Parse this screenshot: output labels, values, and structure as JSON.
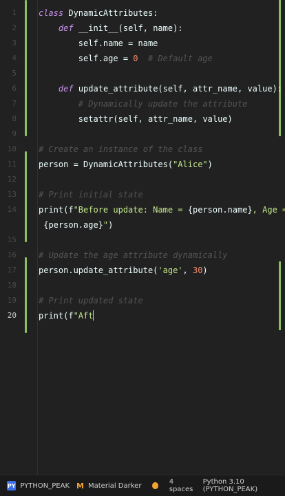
{
  "editor": {
    "line_numbers": [
      "1",
      "2",
      "3",
      "4",
      "5",
      "6",
      "7",
      "8",
      "9",
      "10",
      "11",
      "12",
      "13",
      "14",
      "15",
      "16",
      "17",
      "18",
      "19",
      "20"
    ],
    "lines": [
      [
        {
          "t": "class",
          "c": "kw"
        },
        {
          "t": " DynamicAttributes:",
          "c": "plain"
        }
      ],
      [
        {
          "t": "    ",
          "c": "plain"
        },
        {
          "t": "def",
          "c": "kw"
        },
        {
          "t": " __init__(self, name):",
          "c": "plain"
        }
      ],
      [
        {
          "t": "        self.name = name",
          "c": "plain"
        }
      ],
      [
        {
          "t": "        self.age = ",
          "c": "plain"
        },
        {
          "t": "0",
          "c": "num"
        },
        {
          "t": "  # Default age",
          "c": "cm"
        }
      ],
      [],
      [
        {
          "t": "    ",
          "c": "plain"
        },
        {
          "t": "def",
          "c": "kw"
        },
        {
          "t": " update_attribute(self, attr_name, value):",
          "c": "plain"
        }
      ],
      [
        {
          "t": "        # Dynamically update the attribute",
          "c": "cm"
        }
      ],
      [
        {
          "t": "        setattr(self, attr_name, value)",
          "c": "plain"
        }
      ],
      [],
      [
        {
          "t": "# Create an instance of the class",
          "c": "cm"
        }
      ],
      [
        {
          "t": "person = DynamicAttributes(",
          "c": "plain"
        },
        {
          "t": "\"Alice\"",
          "c": "str"
        },
        {
          "t": ")",
          "c": "plain"
        }
      ],
      [],
      [
        {
          "t": "# Print initial state",
          "c": "cm"
        }
      ],
      [
        {
          "t": "print(f",
          "c": "plain"
        },
        {
          "t": "\"Before update: Name = ",
          "c": "str"
        },
        {
          "t": "{person.name}",
          "c": "plain"
        },
        {
          "t": ", Age =",
          "c": "str"
        }
      ],
      [
        {
          "t": " {person.age}",
          "c": "plain"
        },
        {
          "t": "\"",
          "c": "str"
        },
        {
          "t": ")",
          "c": "plain"
        }
      ],
      [],
      [
        {
          "t": "# Update the age attribute dynamically",
          "c": "cm"
        }
      ],
      [
        {
          "t": "person.update_attribute(",
          "c": "plain"
        },
        {
          "t": "'age'",
          "c": "str"
        },
        {
          "t": ", ",
          "c": "plain"
        },
        {
          "t": "30",
          "c": "num"
        },
        {
          "t": ")",
          "c": "plain"
        }
      ],
      [],
      [
        {
          "t": "# Print updated state",
          "c": "cm"
        }
      ],
      [
        {
          "t": "print(f",
          "c": "plain"
        },
        {
          "t": "\"Aft",
          "c": "str"
        }
      ]
    ]
  },
  "statusbar": {
    "project_badge": "PY",
    "project_name": "PYTHON_PEAK",
    "theme_icon": "M",
    "theme_name": "Material Darker",
    "indent": "4 spaces",
    "interpreter": "Python 3.10 (PYTHON_PEAK)"
  },
  "colors": {
    "background": "#212121",
    "keyword": "#c792ea",
    "comment": "#545454",
    "string": "#c3e88d",
    "number": "#f78c6c",
    "vcs_modified": "#8cbf5e",
    "caret": "#ffcc00",
    "python_badge": "#3b6eea",
    "notification_dot": "#f4a233"
  }
}
